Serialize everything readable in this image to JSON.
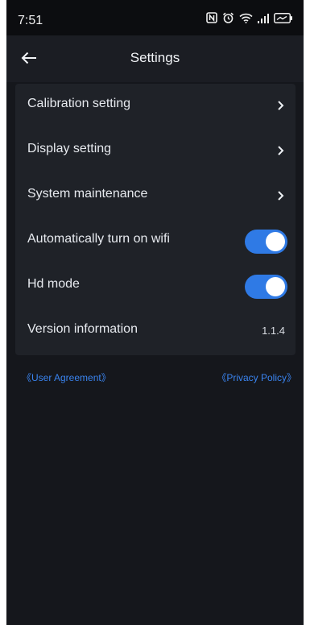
{
  "status_bar": {
    "time": "7:51",
    "icons": [
      "nfc-icon",
      "alarm-icon",
      "wifi-icon",
      "signal-icon",
      "battery-charging-icon"
    ]
  },
  "header": {
    "title": "Settings",
    "back_icon": "back-arrow-icon"
  },
  "settings": {
    "items": [
      {
        "label": "Calibration setting",
        "control": "chevron"
      },
      {
        "label": "Display setting",
        "control": "chevron"
      },
      {
        "label": "System maintenance",
        "control": "chevron"
      },
      {
        "label": "Automatically turn on wifi",
        "control": "toggle",
        "on": true
      },
      {
        "label": "Hd mode",
        "control": "toggle",
        "on": true
      },
      {
        "label": "Version information",
        "control": "value",
        "value": "1.1.4"
      }
    ]
  },
  "footer_links": {
    "user_agreement": "《User Agreement》",
    "privacy_policy": "《Privacy Policy》"
  },
  "colors": {
    "background": "#15171c",
    "card": "#1f2228",
    "accent": "#2f7ae5",
    "link": "#3a84f0"
  }
}
